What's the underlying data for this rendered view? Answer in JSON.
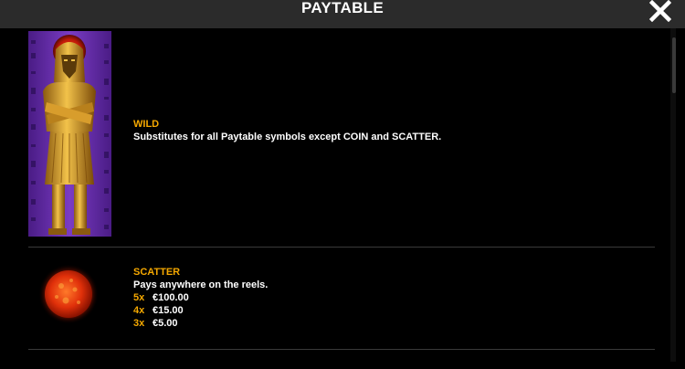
{
  "header": {
    "title": "PAYTABLE",
    "close_icon": "close-x-icon"
  },
  "entries": [
    {
      "name": "WILD",
      "description": "Substitutes for all Paytable symbols except COIN and SCATTER.",
      "image": "pharaoh-wild-symbol"
    },
    {
      "name": "SCATTER",
      "description": "Pays anywhere on the reels.",
      "image": "sun-scatter-symbol",
      "payouts": [
        {
          "count": "5x",
          "value": "€100.00"
        },
        {
          "count": "4x",
          "value": "€15.00"
        },
        {
          "count": "3x",
          "value": "€5.00"
        }
      ]
    }
  ],
  "colors": {
    "accent": "#f5a800",
    "header_bg": "#2b2b2b",
    "background": "#000000",
    "wild_bg": "#6b2fa8"
  }
}
